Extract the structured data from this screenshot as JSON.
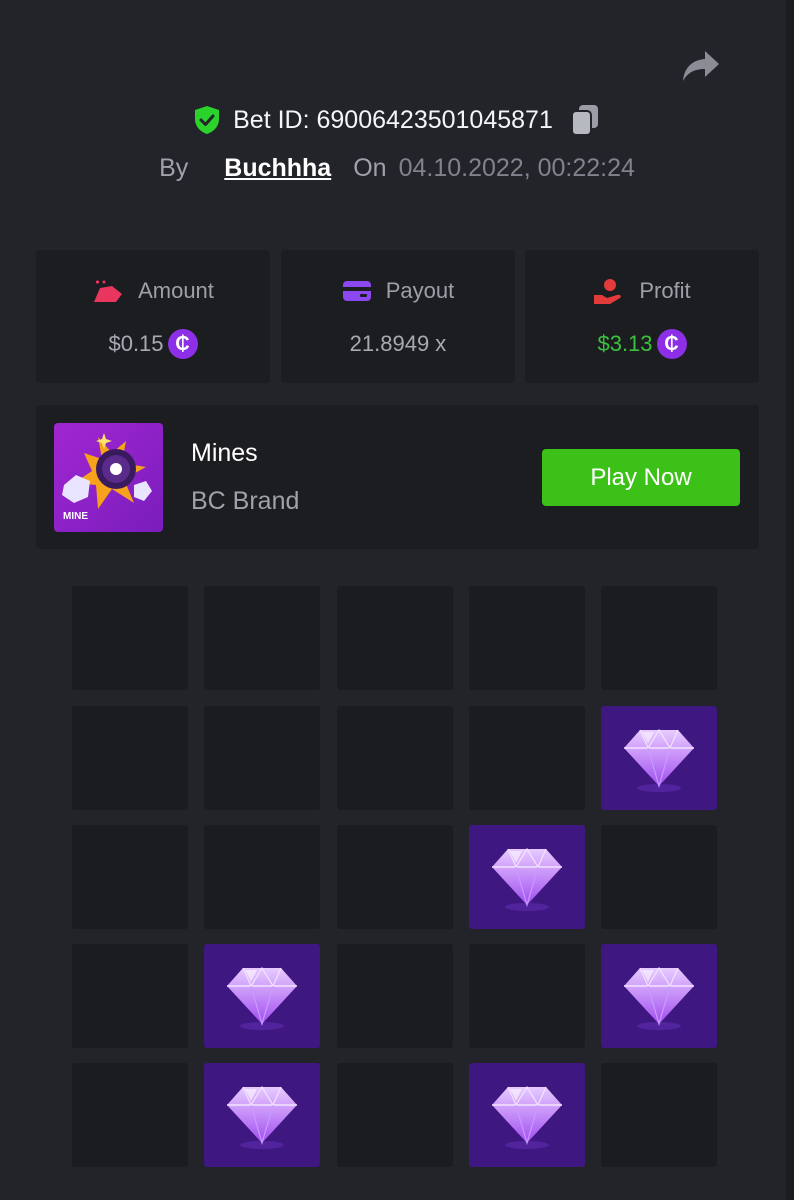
{
  "header": {
    "bet_id_label": "Bet ID: 69006423501045871",
    "by_label": "By",
    "username": "Buchhha",
    "on_label": "On",
    "date": "04.10.2022, 00:22:24"
  },
  "stats": {
    "amount": {
      "label": "Amount",
      "value": "$0.15"
    },
    "payout": {
      "label": "Payout",
      "value": "21.8949 x"
    },
    "profit": {
      "label": "Profit",
      "value": "$3.13"
    }
  },
  "game": {
    "name": "Mines",
    "brand": "BC Brand",
    "thumb_label": "MINE",
    "play_label": "Play Now"
  },
  "board": {
    "rows": 5,
    "cols": 5,
    "tiles": [
      [
        "empty",
        "empty",
        "empty",
        "empty",
        "empty"
      ],
      [
        "empty",
        "empty",
        "empty",
        "empty",
        "gem"
      ],
      [
        "empty",
        "empty",
        "empty",
        "gem",
        "empty"
      ],
      [
        "empty",
        "gem",
        "empty",
        "empty",
        "gem"
      ],
      [
        "empty",
        "gem",
        "empty",
        "gem",
        "empty"
      ]
    ]
  },
  "colors": {
    "background": "#232429",
    "card": "#1c1d21",
    "gem_tile": "#3f1781",
    "play_button": "#3bc117",
    "profit_green": "#3cc13c",
    "coin_purple": "#8c2fe6",
    "shield_green": "#2bd22b"
  },
  "icons": {
    "share": "share-arrow-icon",
    "shield": "shield-check-icon",
    "copy": "copy-icon",
    "amount": "amount-icon",
    "payout": "wallet-icon",
    "profit": "profit-hand-icon",
    "coin": "coin-icon",
    "gem": "gem-icon"
  }
}
